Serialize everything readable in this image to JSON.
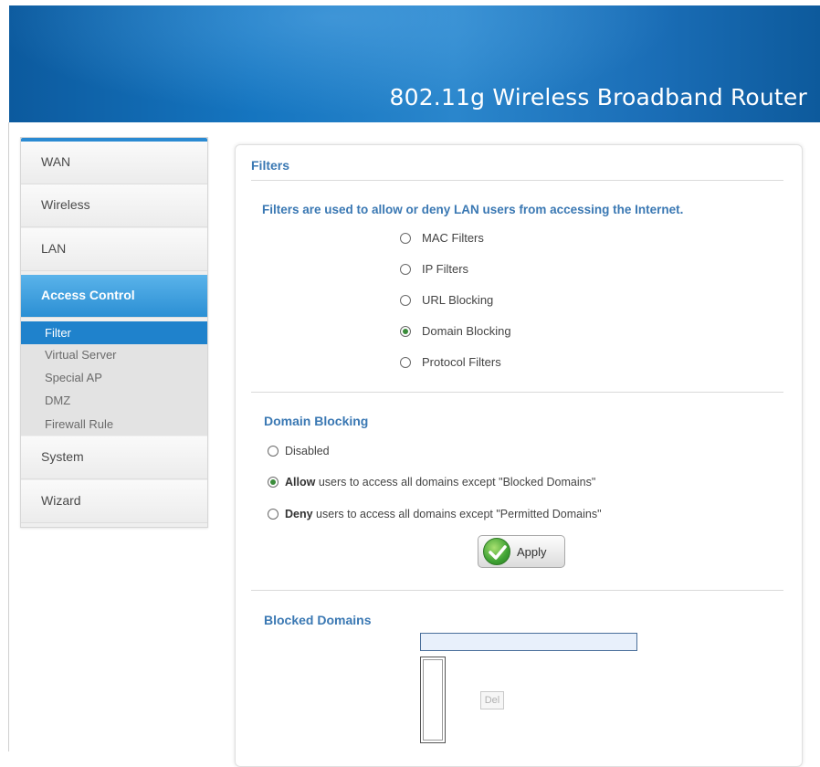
{
  "header": {
    "title": "802.11g Wireless Broadband Router"
  },
  "sidebar": {
    "items": [
      {
        "label": "WAN"
      },
      {
        "label": "Wireless"
      },
      {
        "label": "LAN"
      },
      {
        "label": "Access Control",
        "active": true
      },
      {
        "label": "System"
      },
      {
        "label": "Wizard"
      }
    ],
    "sub_items": [
      {
        "label": "Filter",
        "selected": true
      },
      {
        "label": "Virtual Server"
      },
      {
        "label": "Special AP"
      },
      {
        "label": "DMZ"
      },
      {
        "label": "Firewall Rule"
      }
    ]
  },
  "main": {
    "title": "Filters",
    "intro": "Filters are used to allow or deny LAN users from accessing the Internet.",
    "filter_options": [
      {
        "label": "MAC Filters",
        "checked": false
      },
      {
        "label": "IP Filters",
        "checked": false
      },
      {
        "label": "URL Blocking",
        "checked": false
      },
      {
        "label": "Domain Blocking",
        "checked": true
      },
      {
        "label": "Protocol Filters",
        "checked": false
      }
    ],
    "domain_blocking": {
      "title": "Domain Blocking",
      "disabled_label": "Disabled",
      "allow_bold": "Allow",
      "allow_rest": " users to access all domains except \"Blocked Domains\"",
      "deny_bold": "Deny",
      "deny_rest": " users to access all domains except \"Permitted Domains\"",
      "selected": "allow"
    },
    "apply_label": "Apply",
    "blocked_domains": {
      "title": "Blocked Domains",
      "input_value": "",
      "del_label": "Del"
    }
  },
  "colors": {
    "accent": "#3a78b3",
    "nav_active": "#2b8fd4",
    "header": "#1575c0"
  }
}
